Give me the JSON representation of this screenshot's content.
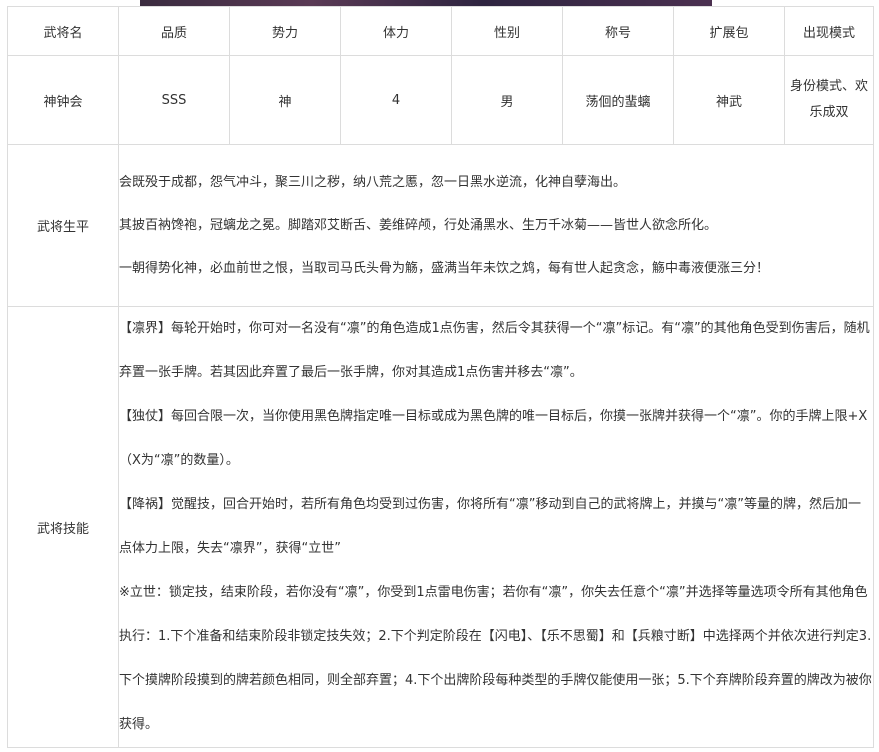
{
  "header": {
    "columns": [
      "武将名",
      "品质",
      "势力",
      "体力",
      "性别",
      "称号",
      "扩展包",
      "出现模式"
    ]
  },
  "general": {
    "name": "神钟会",
    "quality": "SSS",
    "faction": "神",
    "hp": "4",
    "gender": "男",
    "title": "荡佪的蜚螭",
    "pack": "神武",
    "modes": "身份模式、欢乐成双"
  },
  "biography": {
    "label": "武将生平",
    "paragraphs": [
      "会既殁于成都，怨气冲斗，聚三川之秽，纳八荒之慝，忽一日黑水逆流，化神自孽海出。",
      "其披百衲馋袍，冠螭龙之冕。脚踏邓艾断舌、姜维碎颅，行处涌黑水、生万千冰菊——皆世人欲念所化。",
      "一朝得势化神，必血前世之恨，当取司马氏头骨为觞，盛满当年未饮之鸩，每有世人起贪念，觞中毒液便涨三分！"
    ]
  },
  "skills": {
    "label": "武将技能",
    "paragraphs": [
      "【凛界】每轮开始时，你可对一名没有“凛”的角色造成1点伤害，然后令其获得一个“凛”标记。有“凛”的其他角色受到伤害后，随机弃置一张手牌。若其因此弃置了最后一张手牌，你对其造成1点伤害并移去“凛”。",
      "【独仗】每回合限一次，当你使用黑色牌指定唯一目标或成为黑色牌的唯一目标后，你摸一张牌并获得一个“凛”。你的手牌上限+X（X为“凛”的数量）。",
      "【降祸】觉醒技，回合开始时，若所有角色均受到过伤害，你将所有“凛”移动到自己的武将牌上，并摸与“凛”等量的牌，然后加一点体力上限，失去“凛界”，获得“立世”",
      "※立世：锁定技，结束阶段，若你没有“凛”，你受到1点雷电伤害；若你有“凛”，你失去任意个“凛”并选择等量选项令所有其他角色执行：1.下个准备和结束阶段非锁定技失效；2.下个判定阶段在【闪电】、【乐不思蜀】和【兵粮寸断】中选择两个并依次进行判定3.下个摸牌阶段摸到的牌若颜色相同，则全部弃置；4.下个出牌阶段每种类型的手牌仅能使用一张；5.下个弃牌阶段弃置的牌改为被你获得。"
    ]
  }
}
